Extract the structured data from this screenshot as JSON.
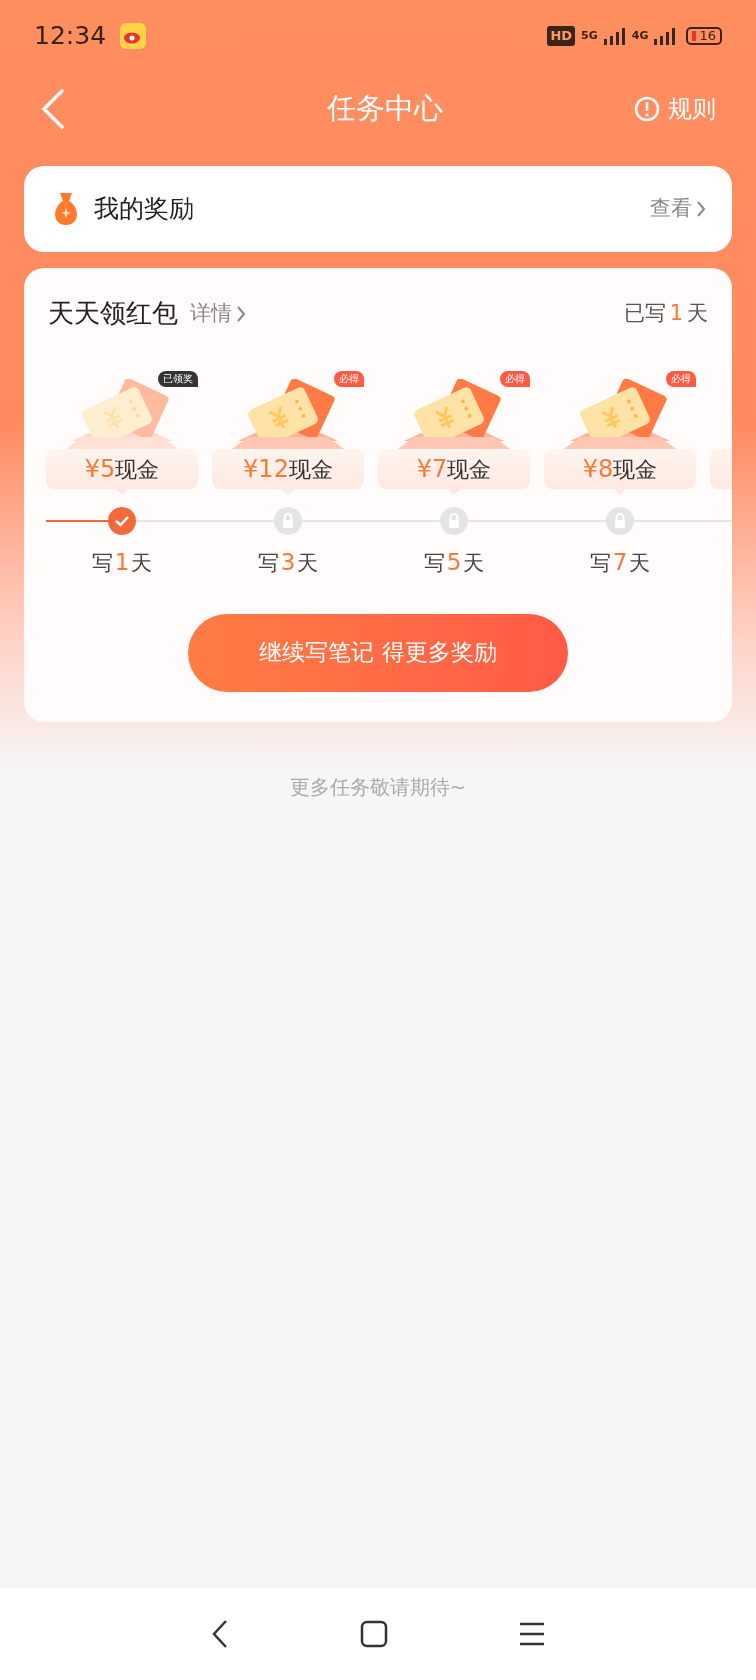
{
  "status_bar": {
    "time": "12:34",
    "hd": "HD",
    "network_1": "5G",
    "network_2": "4G",
    "battery": "16"
  },
  "header": {
    "title": "任务中心",
    "rules": "规则"
  },
  "my_rewards": {
    "title": "我的奖励",
    "link": "查看"
  },
  "daily": {
    "title": "天天领红包",
    "details": "详情",
    "progress_pre": "已写",
    "progress_num": "1",
    "progress_post": "天",
    "rewards": [
      {
        "kind": "claimed",
        "badge": "已领奖",
        "amount": "¥5",
        "unit": "现金",
        "claimed": true,
        "day_pre": "写",
        "day": "1",
        "day_post": "天"
      },
      {
        "kind": "sure",
        "badge": "必得",
        "amount": "¥12",
        "unit": "现金",
        "claimed": false,
        "day_pre": "写",
        "day": "3",
        "day_post": "天"
      },
      {
        "kind": "sure",
        "badge": "必得",
        "amount": "¥7",
        "unit": "现金",
        "claimed": false,
        "day_pre": "写",
        "day": "5",
        "day_post": "天"
      },
      {
        "kind": "sure",
        "badge": "必得",
        "amount": "¥8",
        "unit": "现金",
        "claimed": false,
        "day_pre": "写",
        "day": "7",
        "day_post": "天"
      }
    ],
    "button": "继续写笔记 得更多奖励"
  },
  "footer_note": "更多任务敬请期待~"
}
